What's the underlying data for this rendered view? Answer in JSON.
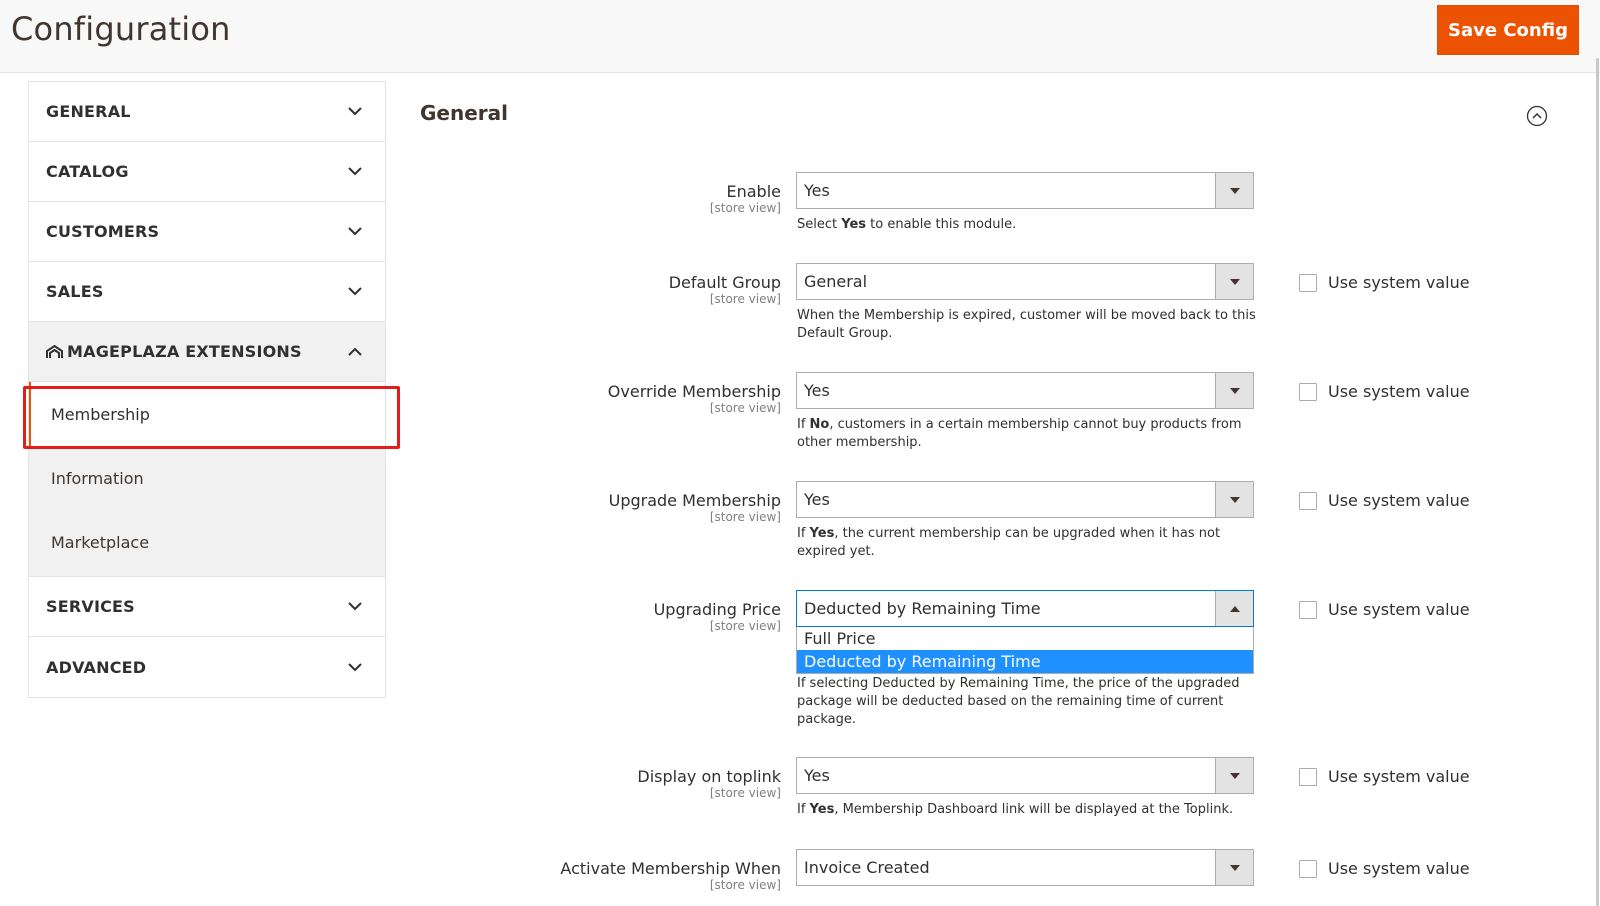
{
  "header": {
    "title": "Configuration",
    "save_label": "Save Config"
  },
  "sidebar": {
    "tabs": [
      {
        "label": "GENERAL"
      },
      {
        "label": "CATALOG"
      },
      {
        "label": "CUSTOMERS"
      },
      {
        "label": "SALES"
      }
    ],
    "extensions": {
      "label": "MAGEPLAZA EXTENSIONS",
      "items": [
        {
          "label": "Membership"
        },
        {
          "label": "Information"
        },
        {
          "label": "Marketplace"
        }
      ]
    },
    "tabs_after": [
      {
        "label": "SERVICES"
      },
      {
        "label": "ADVANCED"
      }
    ]
  },
  "main": {
    "section_title": "General",
    "scope_text": "[store view]",
    "use_system_value": "Use system value",
    "fields": {
      "enable": {
        "label": "Enable",
        "value": "Yes",
        "note_pre": "Select ",
        "note_bold": "Yes",
        "note_post": " to enable this module."
      },
      "default_group": {
        "label": "Default Group",
        "value": "General",
        "note": "When the Membership is expired, customer will be moved back to this Default Group."
      },
      "override": {
        "label": "Override Membership",
        "value": "Yes",
        "note_pre": "If ",
        "note_bold": "No",
        "note_post": ", customers in a certain membership cannot buy products from other membership."
      },
      "upgrade": {
        "label": "Upgrade Membership",
        "value": "Yes",
        "note_pre": "If ",
        "note_bold": "Yes",
        "note_post": ", the current membership can be upgraded when it has not expired yet."
      },
      "upgrading_price": {
        "label": "Upgrading Price",
        "value": "Deducted by Remaining Time",
        "options": [
          "Full Price",
          "Deducted by Remaining Time"
        ],
        "note": "If selecting Deducted by Remaining Time, the price of the upgraded package will be deducted based on the remaining time of current package."
      },
      "toplink": {
        "label": "Display on toplink",
        "value": "Yes",
        "note_pre": "If ",
        "note_bold": "Yes",
        "note_post": ", Membership Dashboard link will be displayed at the Toplink."
      },
      "activate": {
        "label": "Activate Membership When",
        "value": "Invoice Created"
      }
    }
  },
  "colors": {
    "accent": "#eb5202",
    "highlight_box": "#e61c1c",
    "selected_option": "#1e90ff"
  }
}
